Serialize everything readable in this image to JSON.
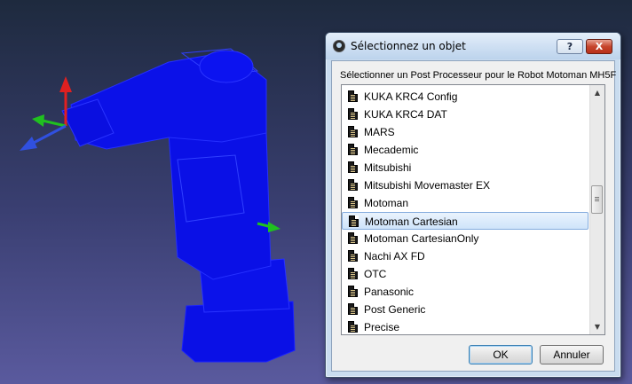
{
  "dialog": {
    "title": "Sélectionnez un objet",
    "help_label": "?",
    "close_label": "X",
    "prompt": "Sélectionner un Post Processeur pour le Robot Motoman MH5F",
    "selected_index": 7,
    "items": [
      "KUKA KRC4 Config",
      "KUKA KRC4 DAT",
      "MARS",
      "Mecademic",
      "Mitsubishi",
      "Mitsubishi Movemaster EX",
      "Motoman",
      "Motoman Cartesian",
      "Motoman CartesianOnly",
      "Nachi AX FD",
      "OTC",
      "Panasonic",
      "Post Generic",
      "Precise"
    ],
    "ok_label": "OK",
    "cancel_label": "Annuler"
  },
  "scrollbar": {
    "up_glyph": "▲",
    "down_glyph": "▼"
  },
  "colors": {
    "robot": "#0a10e6",
    "axis_x": "#e02020",
    "axis_y": "#20c020",
    "axis_z": "#3050e0"
  }
}
